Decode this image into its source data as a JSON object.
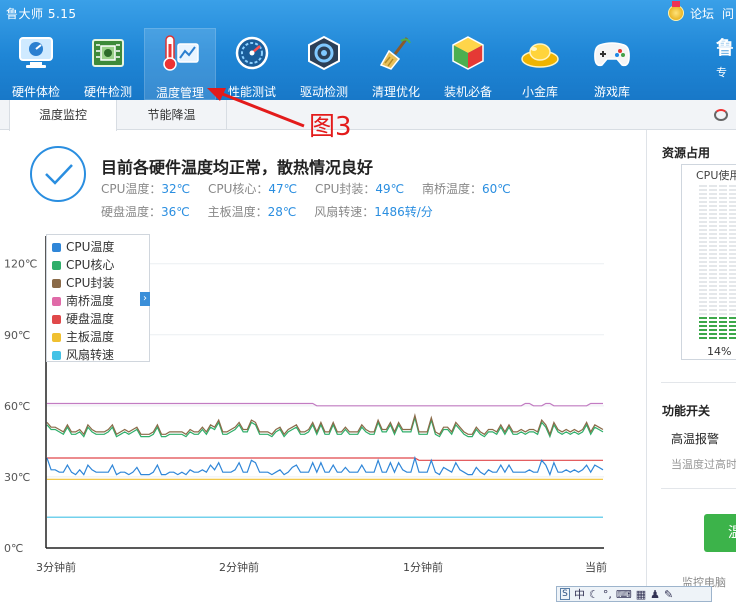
{
  "app": {
    "title": "鲁大师 5.15"
  },
  "top_right": {
    "links": [
      "论坛",
      "问"
    ]
  },
  "toolbar": [
    {
      "label": "硬件体检",
      "icon": "monitor-icon"
    },
    {
      "label": "硬件检测",
      "icon": "circuit-board-icon"
    },
    {
      "label": "温度管理",
      "icon": "thermometer-icon",
      "active": true
    },
    {
      "label": "性能测试",
      "icon": "speedometer-icon"
    },
    {
      "label": "驱动检测",
      "icon": "gear-hexagon-icon"
    },
    {
      "label": "清理优化",
      "icon": "broom-icon"
    },
    {
      "label": "装机必备",
      "icon": "cube-box-icon"
    },
    {
      "label": "小金库",
      "icon": "gold-ingot-icon"
    },
    {
      "label": "游戏库",
      "icon": "gamepad-icon"
    }
  ],
  "profile": {
    "name": "鲁",
    "sub": "专"
  },
  "subtabs": {
    "monitor": "温度监控",
    "cooling": "节能降温"
  },
  "annotation": {
    "text": "图3",
    "color": "#e31b1b"
  },
  "status": {
    "title": "目前各硬件温度均正常，散热情况良好",
    "row1": [
      {
        "label": "CPU温度：",
        "value": "32℃"
      },
      {
        "label": "CPU核心：",
        "value": "47℃"
      },
      {
        "label": "CPU封装：",
        "value": "49℃"
      },
      {
        "label": "南桥温度：",
        "value": "60℃"
      }
    ],
    "row2": [
      {
        "label": "硬盘温度：",
        "value": "36℃"
      },
      {
        "label": "主板温度：",
        "value": "28℃"
      },
      {
        "label": "风扇转速：",
        "value": "1486转/分"
      }
    ]
  },
  "chart_data": {
    "type": "line",
    "y_ticks": [
      "0℃",
      "30℃",
      "60℃",
      "90℃",
      "120℃"
    ],
    "x_ticks": [
      "3分钟前",
      "2分钟前",
      "1分钟前",
      "当前"
    ],
    "ylim": [
      0,
      130
    ],
    "legend": [
      {
        "name": "CPU温度",
        "color": "#2f86d8"
      },
      {
        "name": "CPU核心",
        "color": "#2fae6a"
      },
      {
        "name": "CPU封装",
        "color": "#8a6a48"
      },
      {
        "name": "南桥温度",
        "color": "#e06aa8"
      },
      {
        "name": "硬盘温度",
        "color": "#e0484a"
      },
      {
        "name": "主板温度",
        "color": "#f0c030"
      },
      {
        "name": "风扇转速",
        "color": "#44c2e6"
      }
    ],
    "series": [
      {
        "name": "南桥温度",
        "color": "#c27cc2",
        "values": [
          61,
          61,
          61,
          61,
          61,
          61,
          61,
          61,
          61,
          61,
          61,
          61,
          61,
          61,
          61,
          61,
          61,
          61,
          61,
          61,
          61,
          61,
          61,
          61,
          61,
          61,
          61,
          61,
          61,
          61,
          61,
          61,
          61,
          61,
          61,
          61,
          61,
          61,
          61,
          61,
          61,
          61,
          61,
          61,
          61,
          61,
          61,
          61,
          61,
          61,
          61,
          61,
          61,
          61,
          61,
          61,
          61,
          61,
          61,
          61,
          61,
          61,
          61,
          61,
          61,
          61,
          60,
          60,
          60,
          60,
          60,
          60,
          60,
          60,
          60,
          60,
          60,
          60,
          60,
          60,
          60,
          60,
          60,
          60,
          60,
          60,
          60,
          60,
          60,
          60,
          60,
          60,
          60,
          60,
          60,
          60,
          60,
          60,
          60,
          60,
          60,
          60,
          60,
          60,
          60,
          60,
          60,
          60,
          60,
          60,
          60,
          60,
          60,
          60,
          60,
          60,
          60,
          61,
          61,
          60,
          60,
          60,
          61,
          61,
          60,
          60,
          60,
          60,
          60,
          60,
          60,
          60,
          60,
          61,
          61,
          61,
          61
        ]
      },
      {
        "name": "CPU核心",
        "color": "#2fae6a",
        "values": [
          52,
          50,
          50,
          49,
          48,
          51,
          48,
          48,
          49,
          47,
          51,
          49,
          48,
          48,
          48,
          49,
          51,
          47,
          48,
          49,
          48,
          49,
          50,
          47,
          47,
          47,
          48,
          51,
          47,
          47,
          48,
          48,
          48,
          48,
          47,
          49,
          48,
          48,
          50,
          48,
          51,
          50,
          53,
          48,
          48,
          49,
          50,
          52,
          49,
          49,
          53,
          52,
          48,
          48,
          48,
          47,
          49,
          50,
          47,
          49,
          50,
          51,
          48,
          48,
          49,
          52,
          48,
          52,
          48,
          48,
          52,
          48,
          48,
          50,
          48,
          48,
          48,
          51,
          49,
          48,
          48,
          53,
          49,
          49,
          52,
          48,
          52,
          49,
          49,
          49,
          55,
          48,
          48,
          48,
          54,
          48,
          47,
          50,
          50,
          48,
          52,
          50,
          48,
          47,
          47,
          50,
          48,
          47,
          49,
          49,
          48,
          51,
          48,
          51,
          48,
          48,
          49,
          48,
          49,
          49,
          48,
          53,
          51,
          47,
          52,
          49,
          48,
          49,
          48,
          49,
          48,
          49,
          52,
          48,
          51,
          50,
          49
        ]
      },
      {
        "name": "CPU封装",
        "color": "#8a6a48",
        "values": [
          53,
          51,
          51,
          50,
          49,
          52,
          49,
          49,
          50,
          48,
          52,
          50,
          49,
          49,
          49,
          50,
          52,
          48,
          49,
          50,
          49,
          50,
          51,
          48,
          48,
          48,
          49,
          52,
          48,
          48,
          49,
          49,
          49,
          49,
          48,
          50,
          49,
          49,
          51,
          49,
          52,
          51,
          54,
          49,
          49,
          50,
          51,
          53,
          50,
          50,
          54,
          53,
          49,
          49,
          49,
          48,
          50,
          51,
          48,
          50,
          51,
          52,
          49,
          49,
          50,
          53,
          49,
          53,
          49,
          49,
          53,
          49,
          49,
          51,
          49,
          49,
          49,
          52,
          50,
          49,
          49,
          54,
          50,
          50,
          53,
          49,
          53,
          50,
          50,
          50,
          56,
          49,
          49,
          49,
          55,
          49,
          48,
          51,
          51,
          49,
          53,
          51,
          49,
          48,
          48,
          51,
          49,
          48,
          50,
          50,
          49,
          52,
          49,
          52,
          49,
          49,
          50,
          49,
          50,
          50,
          49,
          54,
          52,
          48,
          53,
          50,
          49,
          50,
          49,
          50,
          49,
          50,
          53,
          49,
          52,
          51,
          50
        ]
      },
      {
        "name": "硬盘温度",
        "color": "#e0484a",
        "values": [
          38,
          38,
          38,
          38,
          38,
          38,
          38,
          38,
          38,
          38,
          38,
          38,
          38,
          38,
          38,
          38,
          38,
          38,
          38,
          38,
          38,
          38,
          38,
          38,
          38,
          38,
          38,
          38,
          38,
          38,
          38,
          38,
          38,
          38,
          38,
          38,
          38,
          38,
          38,
          38,
          38,
          38,
          38,
          38,
          38,
          38,
          38,
          38,
          38,
          38,
          38,
          38,
          38,
          38,
          38,
          38,
          38,
          38,
          38,
          38,
          38,
          38,
          38,
          38,
          38,
          38,
          38,
          38,
          38,
          38,
          38,
          38,
          38,
          38,
          38,
          38,
          38,
          38,
          38,
          38,
          38,
          38,
          38,
          38,
          38,
          38,
          38,
          38,
          38,
          38,
          38,
          37,
          37,
          37,
          37,
          37,
          37,
          37,
          37,
          37,
          37,
          37,
          37,
          37,
          37,
          37,
          37,
          37,
          37,
          37,
          37,
          37,
          37,
          37,
          37,
          37,
          37,
          37,
          37,
          37,
          37,
          37,
          37,
          37,
          37,
          37,
          37,
          37,
          37,
          37,
          37,
          37,
          37,
          37,
          37,
          37,
          37
        ]
      },
      {
        "name": "CPU温度",
        "color": "#2f86d8",
        "values": [
          38,
          33,
          33,
          32,
          32,
          35,
          32,
          31,
          33,
          31,
          35,
          33,
          32,
          32,
          32,
          32,
          35,
          31,
          32,
          32,
          31,
          32,
          34,
          31,
          31,
          31,
          32,
          35,
          31,
          31,
          32,
          32,
          31,
          32,
          31,
          33,
          32,
          32,
          33,
          32,
          35,
          33,
          36,
          32,
          32,
          32,
          33,
          36,
          32,
          32,
          37,
          36,
          32,
          32,
          32,
          31,
          32,
          33,
          31,
          32,
          34,
          35,
          32,
          32,
          32,
          36,
          32,
          36,
          32,
          32,
          35,
          32,
          32,
          34,
          32,
          32,
          32,
          35,
          32,
          32,
          32,
          37,
          32,
          32,
          36,
          32,
          36,
          33,
          32,
          32,
          38,
          32,
          32,
          32,
          37,
          32,
          31,
          34,
          33,
          32,
          36,
          33,
          32,
          31,
          31,
          34,
          32,
          31,
          33,
          32,
          32,
          35,
          32,
          35,
          32,
          32,
          32,
          32,
          33,
          32,
          32,
          37,
          35,
          31,
          36,
          32,
          32,
          33,
          32,
          33,
          32,
          33,
          35,
          32,
          35,
          34,
          33
        ]
      },
      {
        "name": "主板温度",
        "color": "#f0c030",
        "values": [
          29,
          29,
          29,
          29,
          29,
          29,
          29,
          29,
          29,
          29,
          29,
          29,
          29,
          29,
          29,
          29,
          29,
          29,
          29,
          29,
          29,
          29,
          29,
          29,
          29,
          29,
          29,
          29,
          29,
          29,
          29,
          29,
          29,
          29,
          29,
          29,
          29,
          29,
          29,
          29,
          29,
          29,
          29,
          29,
          29,
          29,
          29,
          29,
          29,
          29,
          29,
          29,
          29,
          29,
          29,
          29,
          29,
          29,
          29,
          29,
          29,
          29,
          29,
          29,
          29,
          29,
          29,
          29,
          29,
          29,
          29,
          29,
          29,
          29,
          29,
          29,
          29,
          29,
          29,
          29,
          29,
          29,
          29,
          29,
          29,
          29,
          29,
          29,
          29,
          29,
          29,
          29,
          29,
          29,
          29,
          29,
          29,
          29,
          29,
          29,
          29,
          29,
          29,
          29,
          29,
          29,
          29,
          29,
          29,
          29,
          29,
          29,
          29,
          29,
          29,
          29,
          29,
          29,
          29,
          29,
          29,
          29,
          29,
          29,
          29,
          29,
          29,
          29,
          29,
          29,
          29,
          29,
          29,
          29,
          29,
          29,
          29
        ]
      },
      {
        "name": "风扇转速",
        "color": "#44c2e6",
        "values": [
          13,
          13,
          13,
          13,
          13,
          13,
          13,
          13,
          13,
          13,
          13,
          13,
          13,
          13,
          13,
          13,
          13,
          13,
          13,
          13,
          13,
          13,
          13,
          13,
          13,
          13,
          13,
          13,
          13,
          13,
          13,
          13,
          13,
          13,
          13,
          13,
          13,
          13,
          13,
          13,
          13,
          13,
          13,
          13,
          13,
          13,
          13,
          13,
          13,
          13,
          13,
          13,
          13,
          13,
          13,
          13,
          13,
          13,
          13,
          13,
          13,
          13,
          13,
          13,
          13,
          13,
          13,
          13,
          13,
          13,
          13,
          13,
          13,
          13,
          13,
          13,
          13,
          13,
          13,
          13,
          13,
          13,
          13,
          13,
          13,
          13,
          13,
          13,
          13,
          13,
          13,
          13,
          13,
          13,
          13,
          13,
          13,
          13,
          13,
          13,
          13,
          13,
          13,
          13,
          13,
          13,
          13,
          13,
          13,
          13,
          13,
          13,
          13,
          13,
          13,
          13,
          13,
          13,
          13,
          13,
          13,
          13,
          13,
          13,
          13,
          13,
          13,
          13,
          13,
          13,
          13,
          13,
          13,
          13,
          13,
          13,
          13
        ]
      }
    ],
    "grid": true
  },
  "right_panel": {
    "resources_title": "资源占用",
    "cpu_label": "CPU使用",
    "cpu_percent": "14%",
    "cpu_fraction": 0.14,
    "functions_title": "功能开关",
    "alarm_label": "高温报警",
    "alarm_desc": "当温度过高时",
    "button_label": "温",
    "bottom_text": "监控电脑"
  },
  "ime": {
    "mode": "中"
  }
}
